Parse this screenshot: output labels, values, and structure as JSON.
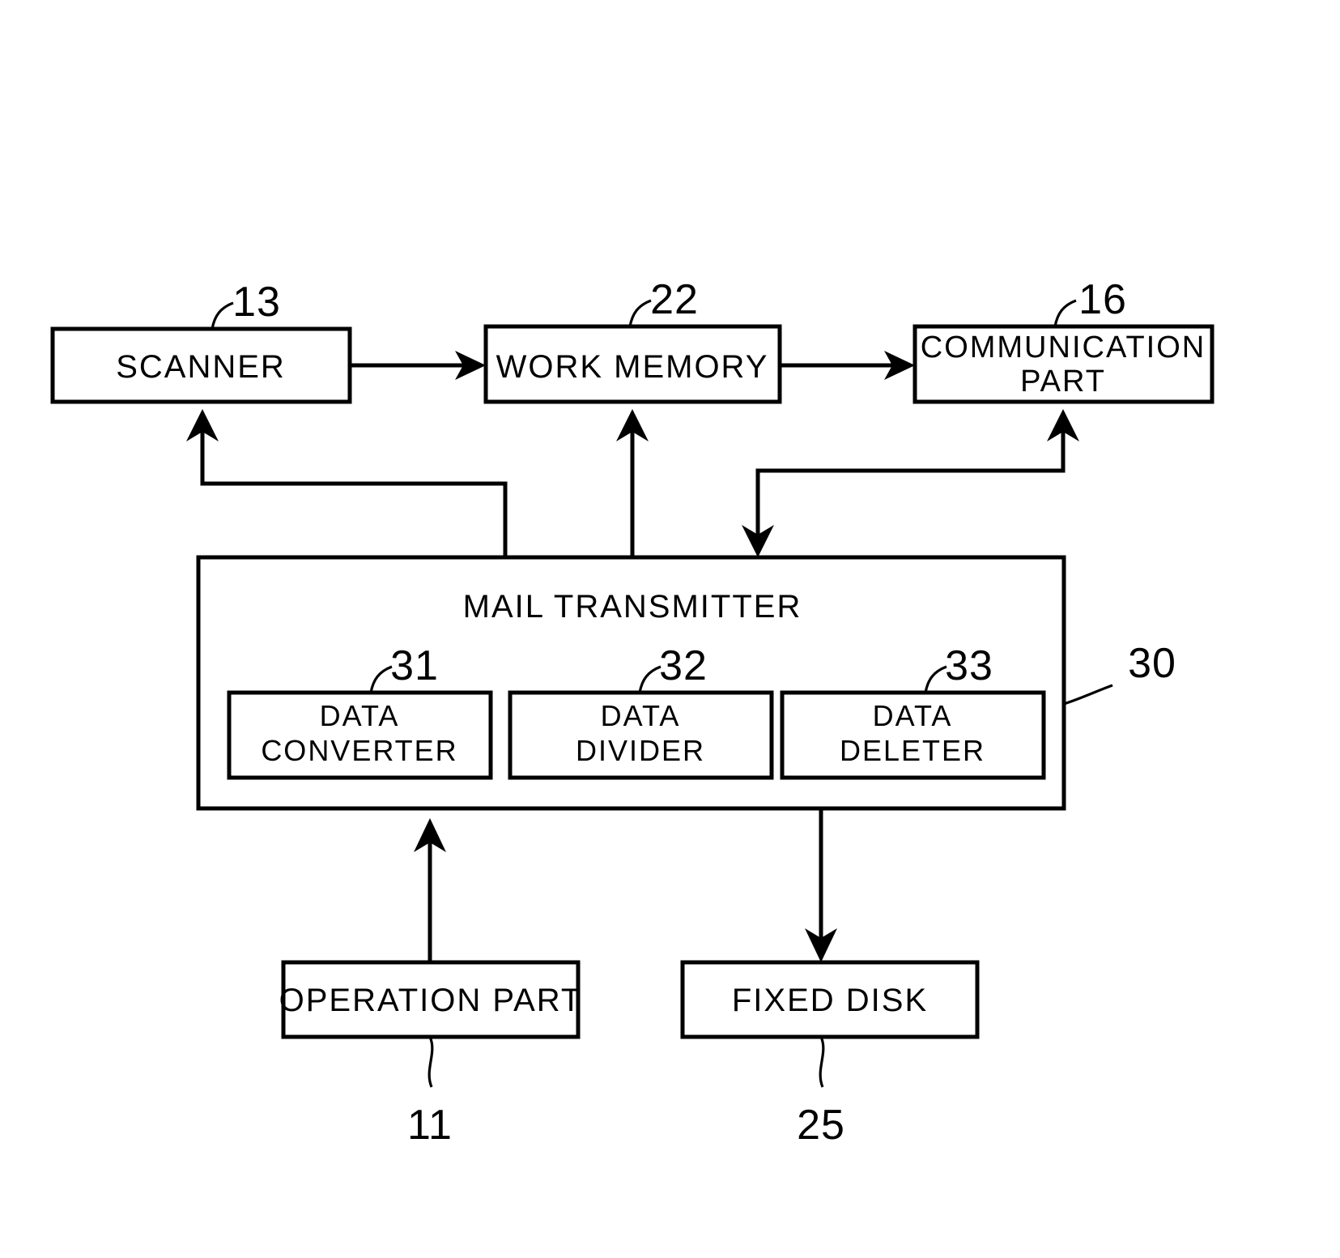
{
  "figure": {
    "kind": "patent-block-diagram",
    "background_color": "#ffffff",
    "line_color": "#000000"
  },
  "blocks": {
    "scanner": {
      "label": "SCANNER",
      "ref": "13"
    },
    "work_memory": {
      "label": "WORK MEMORY",
      "ref": "22"
    },
    "communication_part": {
      "label_line1": "COMMUNICATION",
      "label_line2": "PART",
      "ref": "16"
    },
    "mail_transmitter": {
      "label": "MAIL TRANSMITTER",
      "ref": "30"
    },
    "data_converter": {
      "label_line1": "DATA",
      "label_line2": "CONVERTER",
      "ref": "31"
    },
    "data_divider": {
      "label_line1": "DATA",
      "label_line2": "DIVIDER",
      "ref": "32"
    },
    "data_deleter": {
      "label_line1": "DATA",
      "label_line2": "DELETER",
      "ref": "33"
    },
    "operation_part": {
      "label": "OPERATION PART",
      "ref": "11"
    },
    "fixed_disk": {
      "label": "FIXED DISK",
      "ref": "25"
    }
  },
  "connections": [
    {
      "name": "scanner-to-work-memory",
      "from": "scanner",
      "to": "work_memory",
      "arrow": "end"
    },
    {
      "name": "work-memory-to-communication-part",
      "from": "work_memory",
      "to": "communication_part",
      "arrow": "end"
    },
    {
      "name": "mail-transmitter-to-scanner",
      "from": "mail_transmitter",
      "to": "scanner",
      "arrow": "end"
    },
    {
      "name": "mail-transmitter-to-work-memory",
      "from": "mail_transmitter",
      "to": "work_memory",
      "arrow": "end"
    },
    {
      "name": "mail-transmitter-to-communication-part",
      "from": "mail_transmitter",
      "to": "communication_part",
      "arrow": "both"
    },
    {
      "name": "operation-part-to-mail-transmitter",
      "from": "operation_part",
      "to": "mail_transmitter",
      "arrow": "end"
    },
    {
      "name": "mail-transmitter-to-fixed-disk",
      "from": "mail_transmitter",
      "to": "fixed_disk",
      "arrow": "end"
    }
  ]
}
